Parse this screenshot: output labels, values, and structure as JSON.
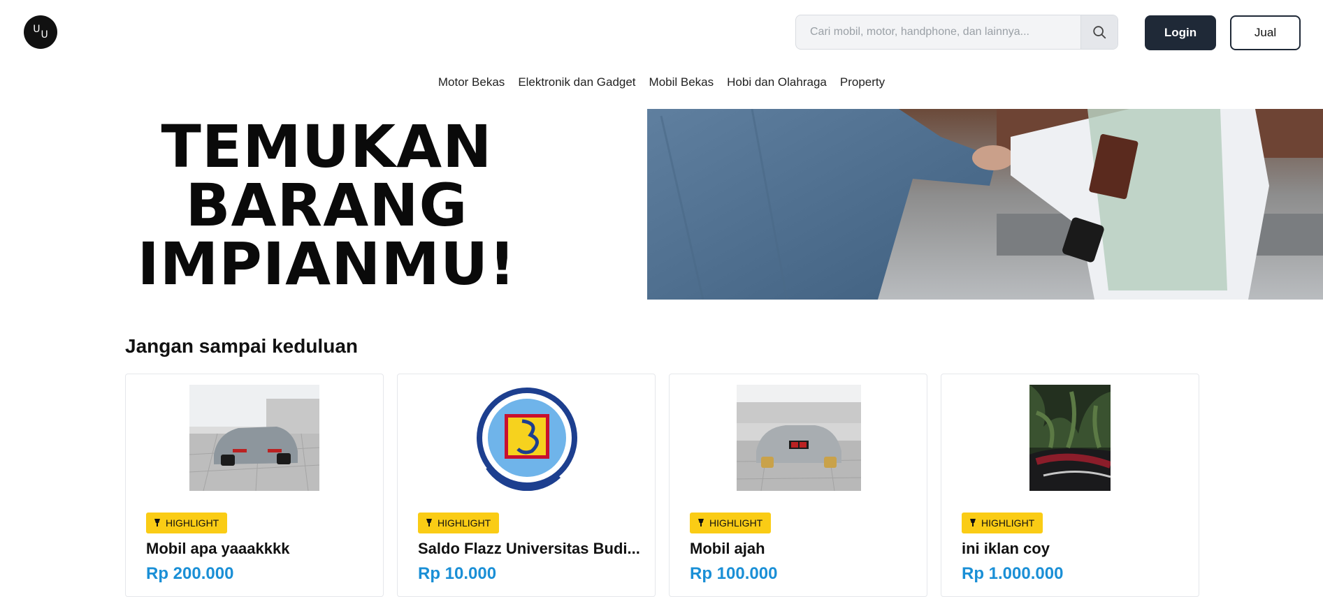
{
  "header": {
    "logo_letters": [
      "U",
      "U"
    ],
    "search": {
      "placeholder": "Cari mobil, motor, handphone, dan lainnya...",
      "value": ""
    },
    "login_label": "Login",
    "sell_label": "Jual"
  },
  "nav": {
    "items": [
      "Motor Bekas",
      "Elektronik dan Gadget",
      "Mobil Bekas",
      "Hobi dan Olahraga",
      "Property"
    ]
  },
  "hero": {
    "lines": [
      "TEMUKAN",
      "BARANG",
      "IMPIANMU!"
    ]
  },
  "section": {
    "title": "Jangan sampai keduluan"
  },
  "cards": [
    {
      "badge": "HIGHLIGHT",
      "title": "Mobil apa yaaakkkk",
      "price": "Rp 200.000"
    },
    {
      "badge": "HIGHLIGHT",
      "title": "Saldo Flazz Universitas Budi...",
      "price": "Rp 10.000"
    },
    {
      "badge": "HIGHLIGHT",
      "title": "Mobil ajah",
      "price": "Rp 100.000"
    },
    {
      "badge": "HIGHLIGHT",
      "title": "ini iklan coy",
      "price": "Rp 1.000.000"
    }
  ],
  "colors": {
    "primary_dark": "#1f2937",
    "highlight_badge": "#facc15",
    "price": "#1a8fd6"
  },
  "icons": [
    "search-icon",
    "lamp-icon"
  ]
}
